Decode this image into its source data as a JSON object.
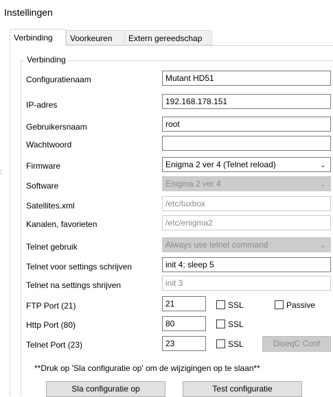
{
  "window": {
    "title": "Instellingen"
  },
  "tabs": [
    {
      "label": "Verbinding",
      "active": true
    },
    {
      "label": "Voorkeuren",
      "active": false
    },
    {
      "label": "Extern gereedschap",
      "active": false
    }
  ],
  "group": {
    "title": "Verbinding"
  },
  "form": {
    "config_name": {
      "label": "Configuratienaam",
      "value": "Mutant HD51"
    },
    "ip": {
      "label": "IP-adres",
      "value": "192.168.178.151"
    },
    "username": {
      "label": "Gebruikersnaam",
      "value": "root"
    },
    "password": {
      "label": "Wachtwoord",
      "value": ""
    },
    "firmware": {
      "label": "Firmware",
      "value": "Enigma 2 ver 4 (Telnet reload)"
    },
    "software": {
      "label": "Software",
      "value": "Enigma 2 ver 4"
    },
    "satellites": {
      "label": "Satellites.xml",
      "value": "/etc/tuxbox"
    },
    "channels": {
      "label": "Kanalen, favorieten",
      "value": "/etc/enigma2"
    },
    "telnet_use": {
      "label": "Telnet gebruik",
      "value": "Always use telnet command"
    },
    "telnet_before": {
      "label": "Telnet voor settings schrijven",
      "value": "init 4; sleep 5"
    },
    "telnet_after": {
      "label": "Telnet na settings shrijven",
      "value": "init 3"
    },
    "ftp_port": {
      "label": "FTP Port (21)",
      "value": "21",
      "ssl_label": "SSL",
      "passive_label": "Passive"
    },
    "http_port": {
      "label": "Http Port (80)",
      "value": "80",
      "ssl_label": "SSL"
    },
    "telnet_port": {
      "label": "Telnet Port (23)",
      "value": "23",
      "ssl_label": "SSL"
    },
    "diseqc_button": "DiseqC Conf"
  },
  "note": "**Druk op 'Sla configuratie op' om de wijzigingen op te slaan**",
  "buttons": {
    "save": "Sla configuratie op",
    "test": "Test configuratie"
  },
  "icons": {
    "dropdown": "chevron-down-icon",
    "edge": "resize-grip-icon"
  }
}
